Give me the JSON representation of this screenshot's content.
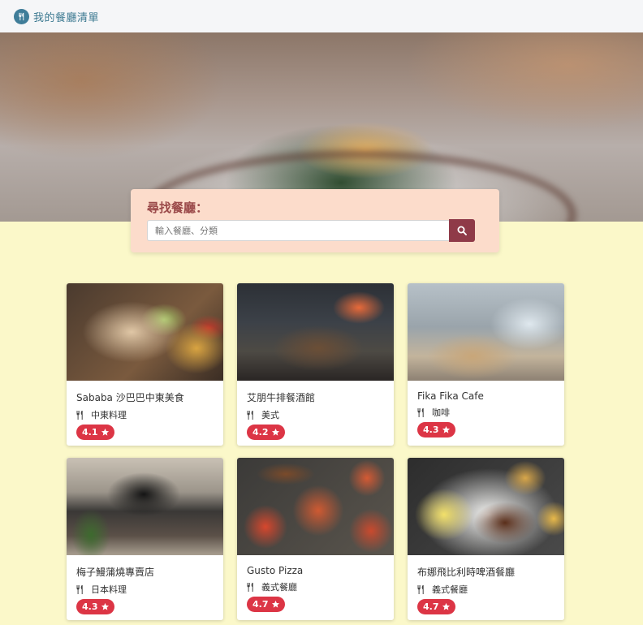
{
  "navbar": {
    "brand_title": "我的餐廳清單",
    "brand_icon": "utensils-icon"
  },
  "search": {
    "title": "尋找餐廳：",
    "placeholder": "輸入餐廳、分類",
    "value": "",
    "button_icon": "search-icon"
  },
  "restaurants": [
    {
      "name": "Sababa 沙巴巴中東美食",
      "category": "中東料理",
      "rating": "4.1"
    },
    {
      "name": "艾朋牛排餐酒館",
      "category": "美式",
      "rating": "4.2"
    },
    {
      "name": "Fika Fika Cafe",
      "category": "咖啡",
      "rating": "4.3"
    },
    {
      "name": "梅子鰻蒲燒專賣店",
      "category": "日本料理",
      "rating": "4.3"
    },
    {
      "name": "Gusto Pizza",
      "category": "義式餐廳",
      "rating": "4.7"
    },
    {
      "name": "布娜飛比利時啤酒餐廳",
      "category": "義式餐廳",
      "rating": "4.7"
    }
  ],
  "colors": {
    "page_background": "#fbf8c9",
    "search_panel": "#fcdccb",
    "search_button": "#8f3a48",
    "rating_badge": "#dc3545",
    "brand": "#3a7890"
  }
}
